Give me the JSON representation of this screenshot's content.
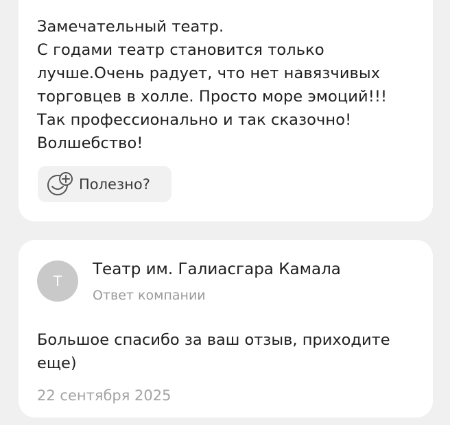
{
  "review": {
    "text": "Замечательный театр.\nС годами театр становится только\nлучше.Очень радует, что нет навязчивых\nторговцев в холле. Просто море эмоций!!!\nТак профессионально и так сказочно!\nВолшебство!",
    "helpful_label": "Полезно?",
    "helpful_icon": "smile-plus-icon"
  },
  "reply": {
    "avatar_letter": "Т",
    "company_name": "Театр им. Галиасгара Камала",
    "subtitle": "Ответ компании",
    "text": "Большое спасибо за ваш отзыв, приходите\nеще)",
    "date": "22 сентября 2025"
  },
  "colors": {
    "background": "#f0f0f0",
    "card": "#ffffff",
    "avatar": "#c9c9c9",
    "muted_text": "#9a9a9a",
    "button_bg": "#f1f1f1"
  }
}
